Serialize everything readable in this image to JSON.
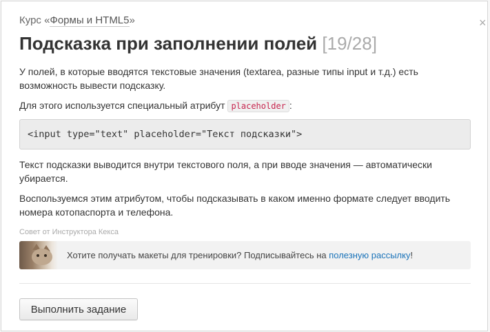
{
  "header": {
    "course_prefix": "Курс «",
    "course_link": "Формы и HTML5",
    "course_suffix": "»",
    "close_glyph": "×",
    "title": "Подсказка при заполнении полей",
    "counter": "[19/28]"
  },
  "body": {
    "p1": "У полей, в которые вводятся текстовые значения (textarea, разные типы input и т.д.) есть возможность вывести подсказку.",
    "p2_before": "Для этого используется специальный атрибут ",
    "p2_code": "placeholder",
    "p2_after": ":",
    "code_block": "<input type=\"text\" placeholder=\"Текст подсказки\">",
    "p3": "Текст подсказки выводится внутри текстового поля, а при вводе значения — автоматически убирается.",
    "p4": "Воспользуемся этим атрибутом, чтобы подсказывать в каком именно формате следует вводить номера котопаспорта и телефона."
  },
  "tip": {
    "label": "Совет от Инструктора Кекса",
    "text_before": "Хотите получать макеты для тренировки? Подписывайтесь на ",
    "link": "полезную рассылку",
    "text_after": "!",
    "avatar_icon": "cat-avatar-icon"
  },
  "footer": {
    "submit_label": "Выполнить задание"
  },
  "colors": {
    "link": "#1a73b9",
    "inline_code": "#c7254e",
    "counter": "#aaaaaa"
  }
}
